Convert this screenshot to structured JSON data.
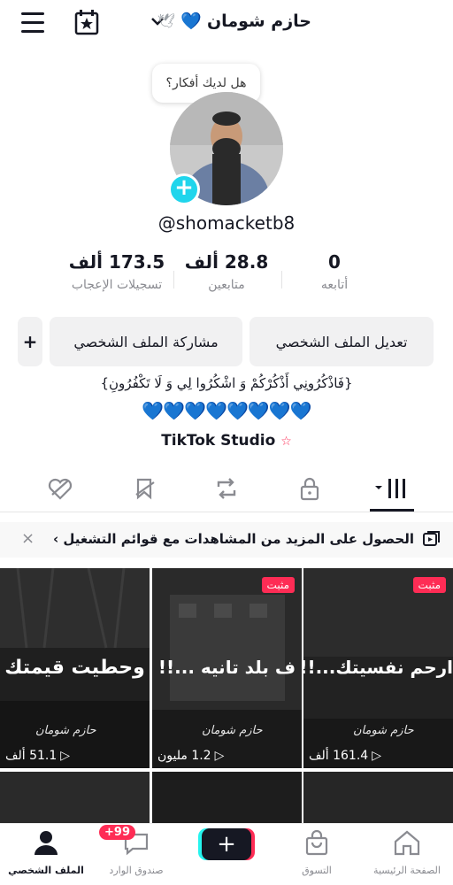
{
  "header": {
    "title": "حازم شومان",
    "title_heart": "💙",
    "title_dove": "🕊"
  },
  "thought_bubble": "هل لديك أفكار؟",
  "profile": {
    "username": "@shomacketb8",
    "avatar_add": "+"
  },
  "stats": [
    {
      "value": "173.5 ألف",
      "label": "تسجيلات الإعجاب"
    },
    {
      "value": "28.8 ألف",
      "label": "متابعين"
    },
    {
      "value": "0",
      "label": "أتابعه"
    }
  ],
  "buttons": {
    "edit_profile": "تعديل الملف الشخصي",
    "share_profile": "مشاركة الملف الشخصي",
    "add_friend": "+"
  },
  "bio": "{فَاذْكُرُونِي أَذْكُرْكُمْ وَ اشْكُرُوا لِي وَ لَا تَكْفُرُونِ}",
  "bio_hearts": "💙💙💙💙💙💙💙💙",
  "studio": {
    "label": "TikTok Studio"
  },
  "banner": {
    "text": "الحصول على المزيد من المشاهدات مع قوائم التشغيل ›",
    "close": "×"
  },
  "videos": [
    {
      "caption": "وحطيت قيمتك",
      "signature": "حازم شومان",
      "views": "51.1 ألف",
      "pinned": ""
    },
    {
      "caption": "ف بلد تانيه ...!!",
      "signature": "حازم شومان",
      "views": "1.2 مليون",
      "pinned": "مثبت"
    },
    {
      "caption": "ارحم نفسيتك...!!!",
      "signature": "حازم شومان",
      "views": "161.4 ألف",
      "pinned": "مثبت"
    }
  ],
  "bottom_nav": {
    "home": "الصفحة الرئيسية",
    "shop": "التسوق",
    "create": "+",
    "inbox": "صندوق الوارد",
    "inbox_badge": "+99",
    "profile": "الملف الشخصي"
  },
  "colors": {
    "accent_red": "#fe2c55",
    "accent_cyan": "#25f4ee",
    "text_dark": "#161823",
    "text_muted": "#8a8b91"
  }
}
